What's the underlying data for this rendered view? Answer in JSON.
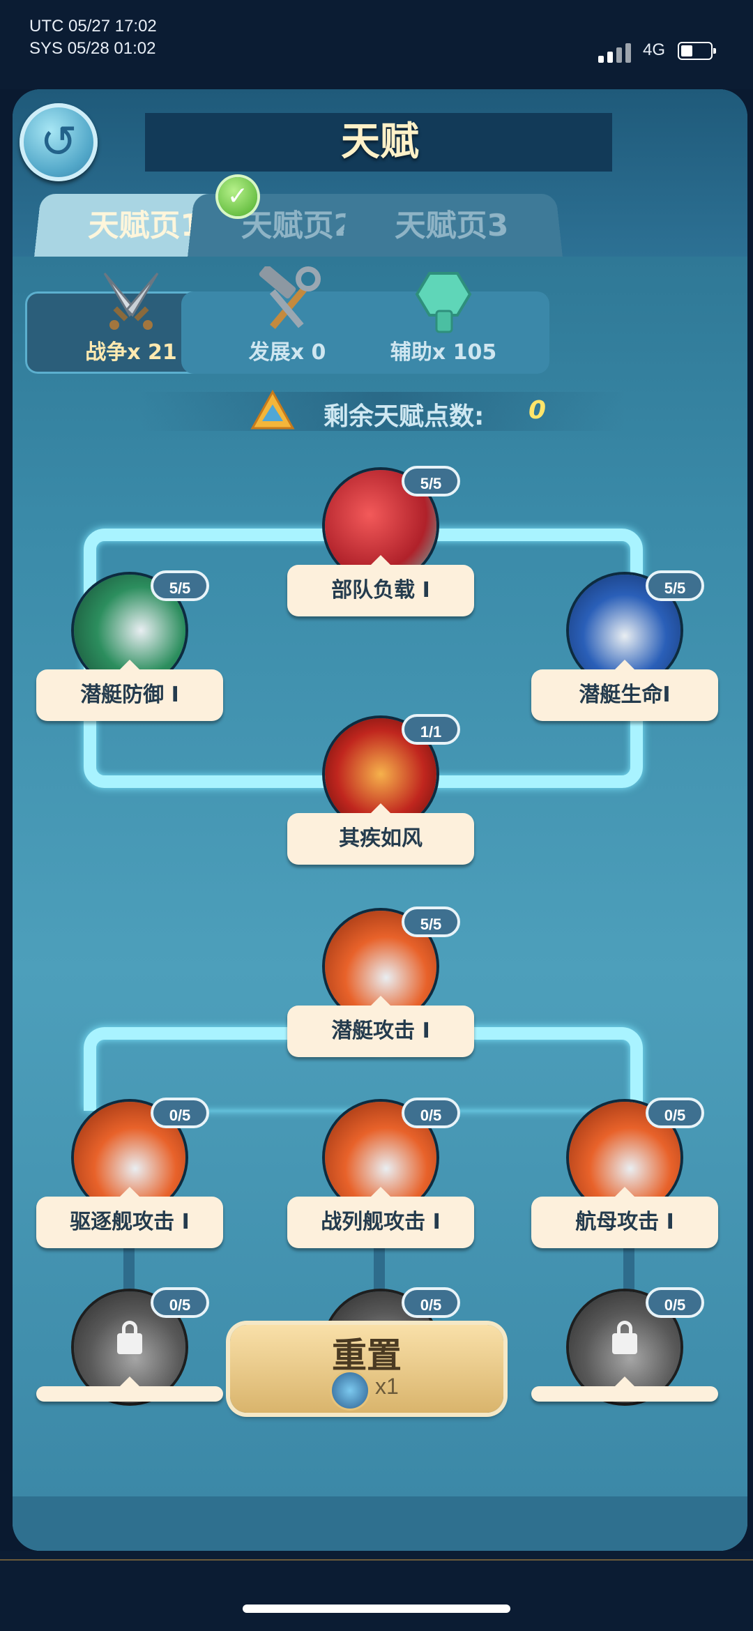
{
  "status_bar": {
    "utc": "UTC 05/27 17:02",
    "sys": "SYS 05/28 01:02",
    "network": "4G"
  },
  "header": {
    "title": "天赋",
    "back_icon": "back-arrow-icon"
  },
  "tabs": [
    {
      "label": "天赋页1",
      "active": true
    },
    {
      "label": "天赋页2",
      "active": false
    },
    {
      "label": "天赋页3",
      "active": false
    }
  ],
  "categories": [
    {
      "label": "战争x 21",
      "icon": "crossed-swords-icon",
      "selected": true
    },
    {
      "label": "发展x 0",
      "icon": "hammer-wrench-icon",
      "selected": false
    },
    {
      "label": "辅助x 105",
      "icon": "bolt-icon",
      "selected": false
    }
  ],
  "remaining": {
    "label": "剩余天赋点数:",
    "value": "0"
  },
  "nodes": {
    "troop_load": {
      "label": "部队负载 I",
      "level": "5/5"
    },
    "sub_defense": {
      "label": "潜艇防御 I",
      "level": "5/5"
    },
    "sub_life": {
      "label": "潜艇生命I",
      "level": "5/5"
    },
    "swift_wind": {
      "label": "其疾如风",
      "level": "1/1"
    },
    "sub_attack": {
      "label": "潜艇攻击 I",
      "level": "5/5"
    },
    "destroyer_attack": {
      "label": "驱逐舰攻击 I",
      "level": "0/5"
    },
    "battleship_attack": {
      "label": "战列舰攻击 I",
      "level": "0/5"
    },
    "carrier_attack": {
      "label": "航母攻击 I",
      "level": "0/5"
    },
    "locked_1": {
      "level": "0/5"
    },
    "locked_2": {
      "level": "0/5"
    },
    "locked_3": {
      "level": "0/5"
    }
  },
  "reset": {
    "label": "重置",
    "count": "x1"
  },
  "colors": {
    "accent_line": "#a9f3ff",
    "plate": "#fdf0dc",
    "value": "#ffe56a"
  }
}
